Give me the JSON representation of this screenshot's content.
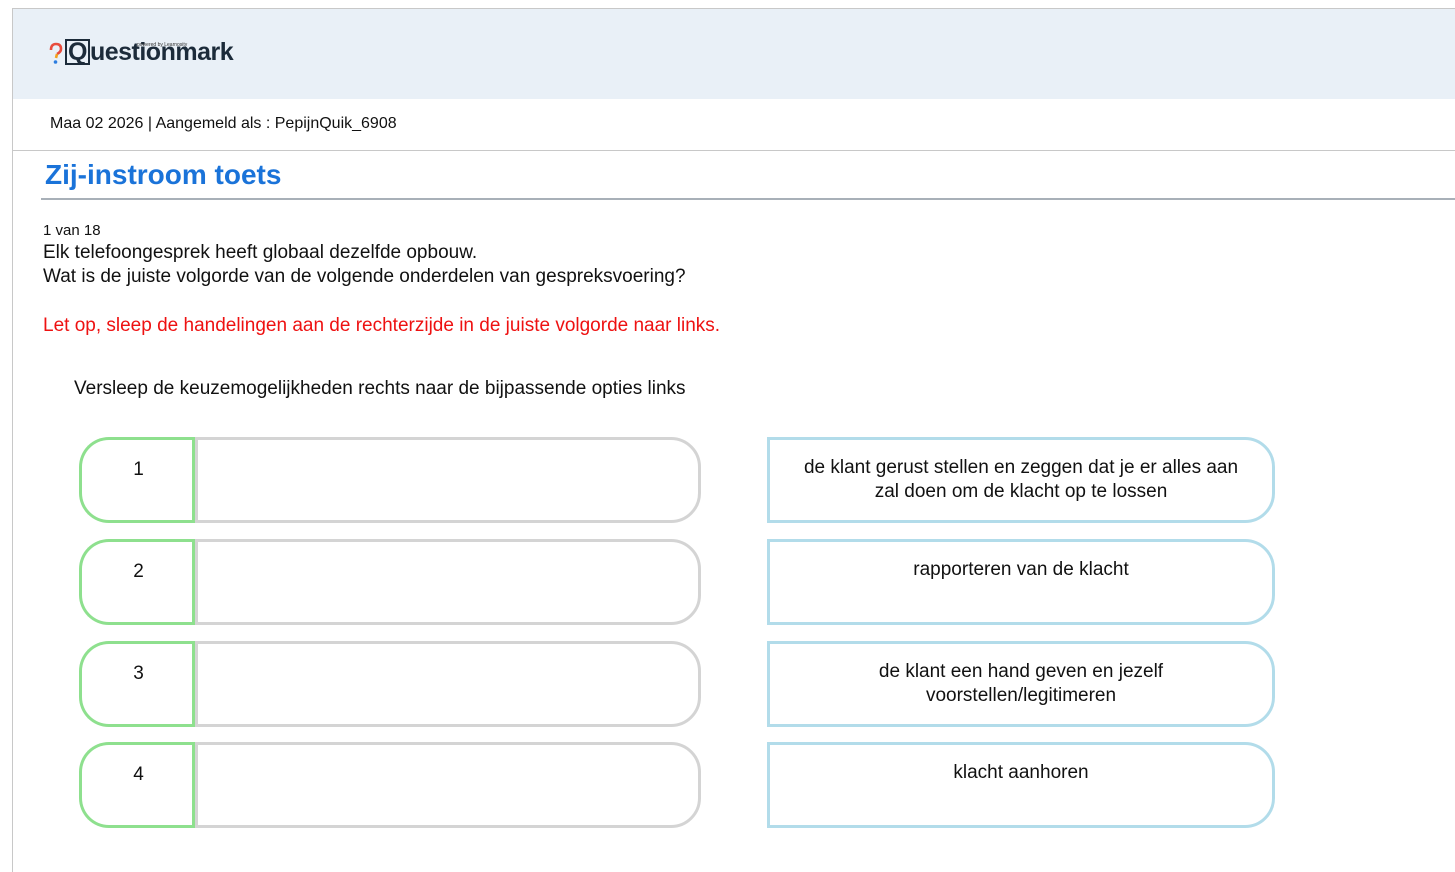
{
  "header": {
    "logo_text": "Questionmark",
    "logo_subtext": "powered by Learnosity",
    "logo_icon": "questionmark-logo-icon"
  },
  "infobar": {
    "text": "Maa 02 2026 |  Aangemeld als : PepijnQuik_6908"
  },
  "assessment": {
    "title": "Zij-instroom toets",
    "counter": "1  van 18",
    "question_line1": "Elk telefoongesprek heeft globaal dezelfde opbouw.",
    "question_line2": "Wat is de juiste volgorde van de volgende onderdelen van gespreksvoering?",
    "warning": "Let op, sleep de handelingen aan de rechterzijde in de juiste volgorde naar links.",
    "instruction": "Versleep de keuzemogelijkheden rechts naar de bijpassende opties links",
    "targets": [
      {
        "number": "1"
      },
      {
        "number": "2"
      },
      {
        "number": "3"
      },
      {
        "number": "4"
      }
    ],
    "choices": [
      {
        "label": "de klant gerust stellen en zeggen dat je er alles aan zal doen om de klacht op te lossen"
      },
      {
        "label": "rapporteren van de klacht"
      },
      {
        "label": "de klant een hand geven en jezelf voorstellen/legitimeren"
      },
      {
        "label": "klacht aanhoren"
      }
    ]
  },
  "colors": {
    "title": "#1a73d9",
    "warning": "#ee1111",
    "target_border": "#8ee08e",
    "choice_border": "#b2dcea",
    "header_bg": "#e9f0f7"
  }
}
